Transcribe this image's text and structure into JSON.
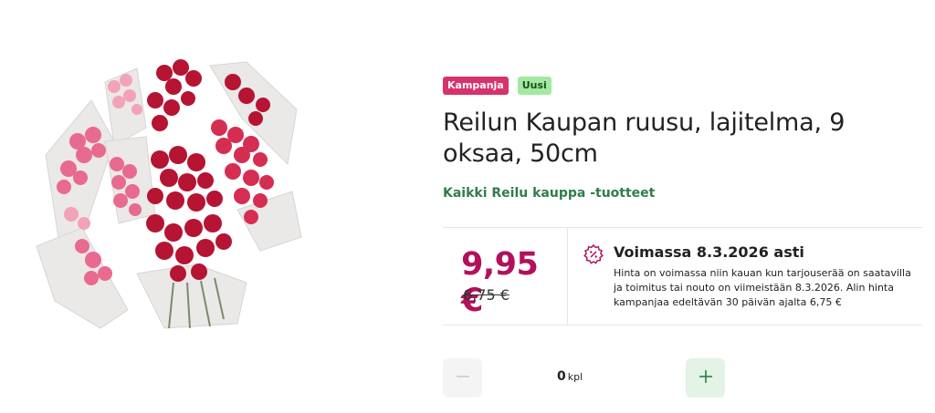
{
  "product": {
    "image_alt": "Reilun Kaupan ruusu, lajitelma, 9 oksaa, 50cm",
    "badges": {
      "campaign": "Kampanja",
      "new": "Uusi"
    },
    "title": "Reilun Kaupan ruusu, lajitelma, 9 oksaa, 50cm",
    "brand_link": "Kaikki Reilu kauppa -tuotteet"
  },
  "pricing": {
    "price": "9,95 €",
    "old_price": "6,75 €",
    "offer_title": "Voimassa 8.3.2026 asti",
    "offer_text": "Hinta on voimassa niin kauan kun tarjouserää on saatavilla ja toimitus tai nouto on viimeistään 8.3.2026. Alin hinta kampanjaa edeltävän 30 päivän ajalta 6,75 €",
    "icon": "discount-percent-icon"
  },
  "quantity": {
    "value": "0",
    "unit": "kpl",
    "minus_icon": "minus-icon",
    "plus_icon": "plus-icon"
  },
  "colors": {
    "campaign_badge": "#d6336c",
    "new_badge": "#a3eaa0",
    "price": "#b3105c",
    "brand_link": "#2f7d4a",
    "plus_button": "#e3f3e6"
  }
}
